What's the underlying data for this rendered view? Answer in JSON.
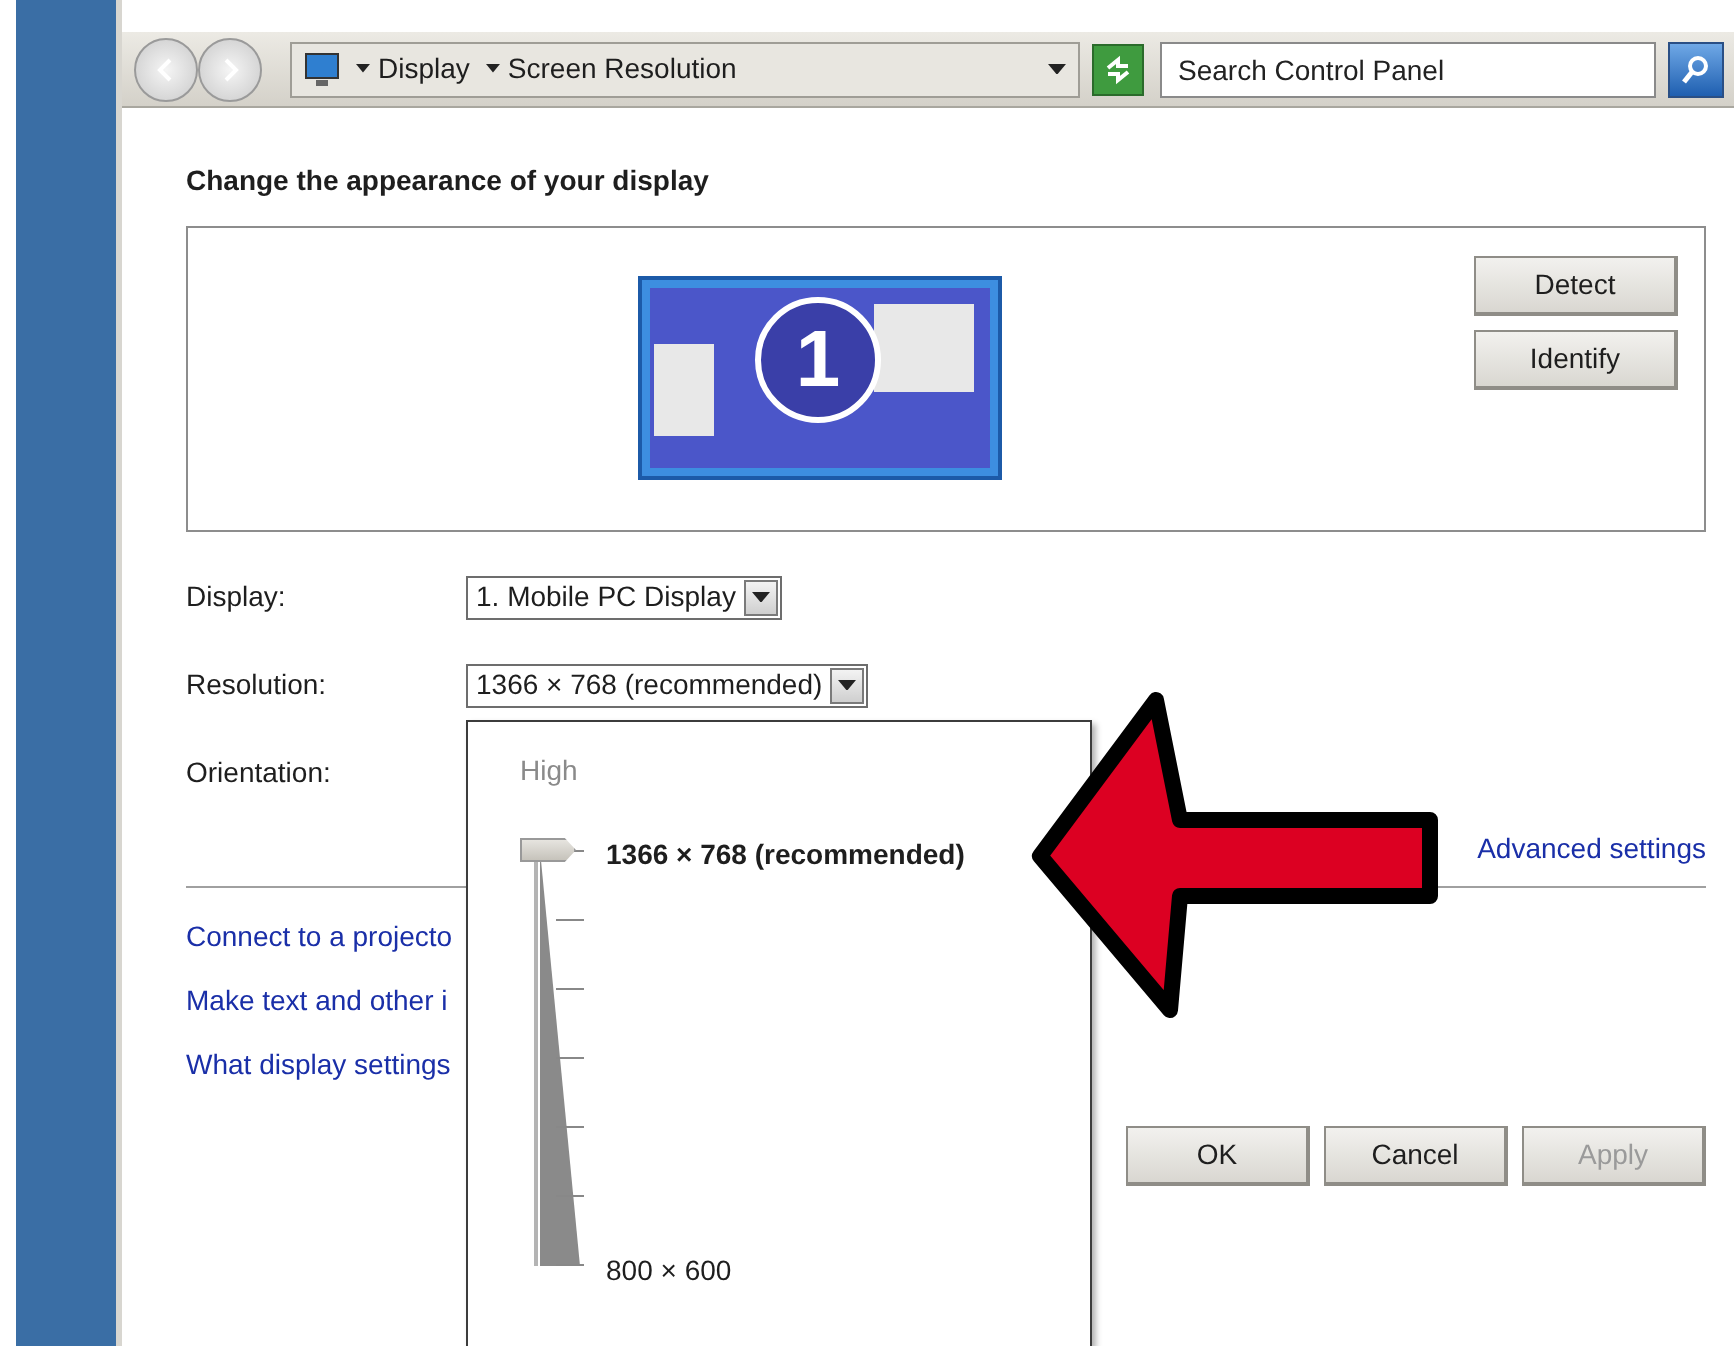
{
  "nav": {
    "breadcrumb": [
      "Display",
      "Screen Resolution"
    ],
    "search": {
      "placeholder": "Search Control Panel"
    }
  },
  "heading": "Change the appearance of your display",
  "preview": {
    "monitor_number": "1",
    "buttons": [
      "Detect",
      "Identify"
    ]
  },
  "fields": [
    {
      "label": "Display:",
      "value": "1. Mobile PC Display"
    },
    {
      "label": "Resolution:",
      "value": "1366 × 768 (recommended)"
    },
    {
      "label": "Orientation:"
    }
  ],
  "resolution_popup": {
    "top_label": "High",
    "level": 1,
    "current": "1366 × 768 (recommended)",
    "bottom_label": "800 × 600"
  },
  "advanced_link": "Advanced settings",
  "links": [
    "Connect to a projecto",
    "Make text and other i",
    "What display settings"
  ],
  "buttons": [
    {
      "label": "OK",
      "disabled": false
    },
    {
      "label": "Cancel",
      "disabled": false
    },
    {
      "label": "Apply",
      "disabled": true
    }
  ]
}
